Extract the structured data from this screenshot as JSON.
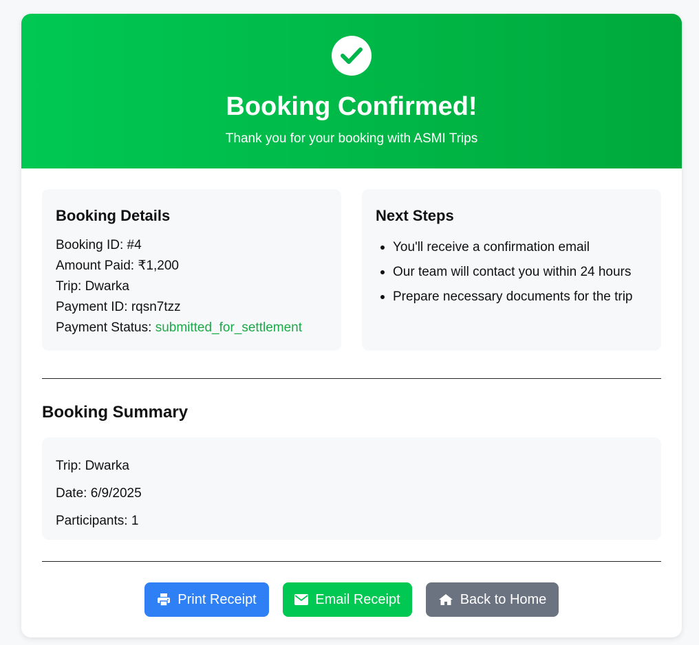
{
  "header": {
    "title": "Booking Confirmed!",
    "subtitle": "Thank you for your booking with ASMI Trips",
    "icon": "check-circle-icon"
  },
  "booking_details": {
    "heading": "Booking Details",
    "booking_id_label": "Booking ID:",
    "booking_id": "#4",
    "amount_label": "Amount Paid:",
    "amount": "₹1,200",
    "trip_label": "Trip:",
    "trip": "Dwarka",
    "payment_id_label": "Payment ID:",
    "payment_id": "rqsn7tzz",
    "payment_status_label": "Payment Status:",
    "payment_status": "submitted_for_settlement"
  },
  "next_steps": {
    "heading": "Next Steps",
    "items": [
      "You'll receive a confirmation email",
      "Our team will contact you within 24 hours",
      "Prepare necessary documents for the trip"
    ]
  },
  "summary": {
    "heading": "Booking Summary",
    "trip_label": "Trip:",
    "trip": "Dwarka",
    "date_label": "Date:",
    "date": "6/9/2025",
    "participants_label": "Participants:",
    "participants": "1"
  },
  "actions": {
    "print_label": "Print Receipt",
    "email_label": "Email Receipt",
    "home_label": "Back to Home"
  },
  "colors": {
    "success": "#00c853",
    "primary": "#2f80f5",
    "secondary": "#6c7380",
    "status_text": "#1aaa48"
  }
}
